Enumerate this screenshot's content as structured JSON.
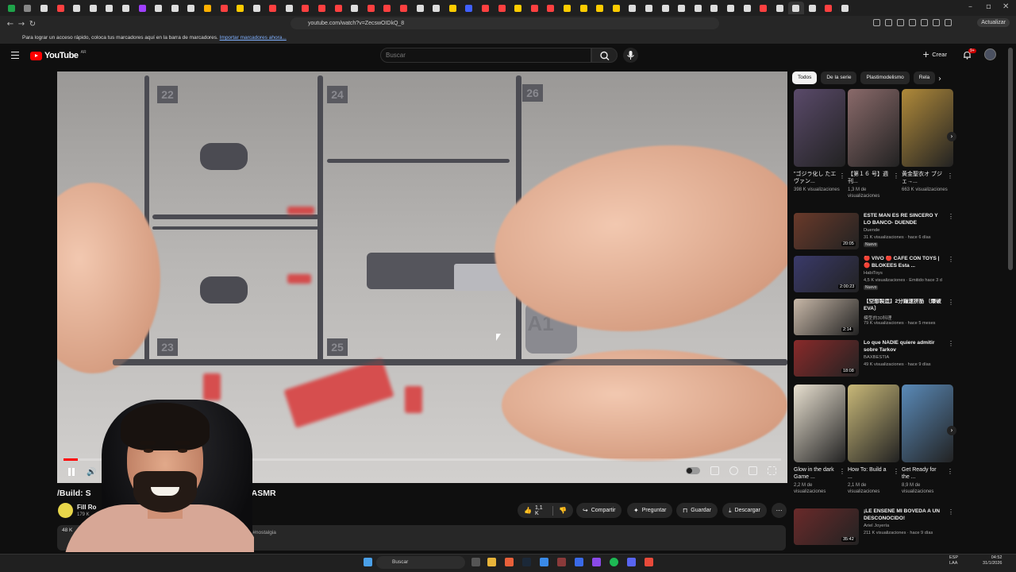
{
  "browser": {
    "url": "youtube.com/watch?v=ZecswOIDkQ_8",
    "update_label": "Actualizar",
    "bookmarks_hint": "Para lograr un acceso rápido, coloca tus marcadores aquí en la barra de marcadores.",
    "bookmarks_link": "Importar marcadores ahora..."
  },
  "header": {
    "logo_text": "YouTube",
    "logo_country": "AR",
    "search_placeholder": "Buscar",
    "create_label": "Crear",
    "notification_count": "9+"
  },
  "player": {
    "progress_fraction": 0.02,
    "part_numbers": [
      "22",
      "24",
      "26",
      "23",
      "25",
      "A1"
    ]
  },
  "video": {
    "title": "/Build: S                                       Model Kit | Music ASMR",
    "channel": "Fill Ro",
    "subs": "179 K",
    "description_hint": "48 K",
    "description_tag": "son #nostalgia",
    "likes": "1,1 K",
    "share": "Compartir",
    "ask": "Preguntar",
    "save": "Guardar",
    "download": "Descargar"
  },
  "sidebar": {
    "chips": [
      "Todos",
      "De la serie",
      "Plastimodelismo",
      "Rela"
    ],
    "shorts_row1": [
      {
        "title": "\"ゴジラ化し たエヴァン...",
        "views": "398 K visualizaciones",
        "color": "#5a4a6a"
      },
      {
        "title": "【第１６ 号】週刊...",
        "views": "1,3 M de visualizaciones",
        "color": "#8a6a6a"
      },
      {
        "title": "黄金聖衣オ ブジェ→...",
        "views": "663 K visualizaciones",
        "color": "#b08a3a"
      }
    ],
    "recs": [
      {
        "title": "ESTE MAN ES RE SINCERO Y LO BANCO- DUENDE REACCIONA...",
        "channel": "Duende",
        "meta": "31 K visualizaciones · hace 6 días",
        "badge": "Nuevo",
        "duration": "20:05",
        "color": "#6a3a2a"
      },
      {
        "title": "🔴 VIVO 🔴 CAFE CON TOYS | 🔴 BLOKEES Esta ...",
        "channel": "HabiToys",
        "meta": "4,5 K visualizaciones · Emitido hace 3 d",
        "badge": "Nuevo",
        "duration": "2:00:23",
        "color": "#3a3a6a"
      },
      {
        "title": "【空想製造】2分鐘速拼筋 〔爆破EVA〕",
        "channel": "模型的30科理",
        "meta": "79 K visualizaciones · hace 5 meses",
        "badge": "",
        "duration": "2:14",
        "color": "#c8b8a8"
      },
      {
        "title": "Lo que NADIE quiere admitir sobre Tarkov",
        "channel": "BAXBESTIA",
        "meta": "49 K visualizaciones · hace 9 días",
        "badge": "",
        "duration": "18:08",
        "color": "#8a2a2a"
      }
    ],
    "shorts_row2": [
      {
        "title": "Glow in the dark Game ...",
        "views": "2,2 M de visualizaciones",
        "color": "#e8e0d0"
      },
      {
        "title": "How To: Build a ...",
        "views": "2,1 M de visualizaciones",
        "color": "#c8b878"
      },
      {
        "title": "Get Ready for the ...",
        "views": "8,9 M de visualizaciones",
        "color": "#5a8ab8"
      }
    ],
    "rec_last": {
      "title": "¡LE ENSEÑÉ MI BÓVEDA A UN DESCONOCIDO!",
      "channel": "Ariel Joyería",
      "meta": "211 K visualizaciones · hace 9 días",
      "duration": "35:42",
      "color": "#6a2a2a"
    }
  },
  "taskbar": {
    "search_label": "Buscar",
    "lang_line1": "ESP",
    "lang_line2": "LAA",
    "time": "04:52",
    "date": "31/1/2026"
  },
  "tab_colors": [
    "#1fa34a",
    "#888",
    "#ddd",
    "#ff4040",
    "#ddd",
    "#ddd",
    "#ddd",
    "#ddd",
    "#a040ff",
    "#ddd",
    "#ddd",
    "#ddd",
    "#ffb000",
    "#ff4040",
    "#ffcc00",
    "#ddd",
    "#ff4040",
    "#ddd",
    "#ff4040",
    "#ff4040",
    "#ff4040",
    "#ddd",
    "#ff4040",
    "#ff4040",
    "#ff4040",
    "#ddd",
    "#ddd",
    "#ffcc00",
    "#4060ff",
    "#ff4040",
    "#ff4040",
    "#ffcc00",
    "#ff4040",
    "#ff4040",
    "#ffcc00",
    "#ffcc00",
    "#ffcc00",
    "#ffcc00",
    "#ddd",
    "#ddd",
    "#ddd",
    "#ddd",
    "#ddd",
    "#ddd",
    "#ddd",
    "#ddd",
    "#ff4040",
    "#ddd",
    "#ddd",
    "#ddd",
    "#ff4040",
    "#ddd"
  ]
}
